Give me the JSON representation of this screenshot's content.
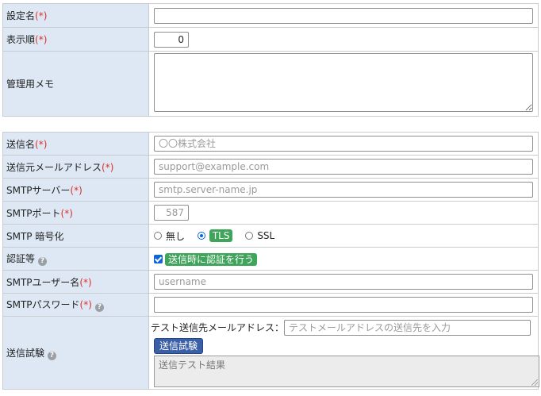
{
  "section1": {
    "setting_name_label": "設定名",
    "setting_name_value": "",
    "order_label": "表示順",
    "order_value": "0",
    "memo_label": "管理用メモ",
    "memo_value": ""
  },
  "required_mark": "(*)",
  "section2": {
    "sender_name_label": "送信名",
    "sender_name_placeholder": "〇〇株式会社",
    "sender_addr_label": "送信元メールアドレス",
    "sender_addr_placeholder": "support@example.com",
    "server_label": "SMTPサーバー",
    "server_placeholder": "smtp.server-name.jp",
    "port_label": "SMTPポート",
    "port_placeholder": "587",
    "enc_label": "SMTP 暗号化",
    "enc_options": [
      "無し",
      "TLS",
      "SSL"
    ],
    "enc_selected": "TLS",
    "auth_label": "認証等",
    "auth_checkbox_label": "送信時に認証を行う",
    "auth_checked": true,
    "user_label": "SMTPユーザー名",
    "user_placeholder": "username",
    "password_label": "SMTPパスワード",
    "test_label": "送信試験",
    "test_addr_label": "テスト送信先メールアドレス：",
    "test_addr_placeholder": "テストメールアドレスの送信先を入力",
    "test_button": "送信試験",
    "test_result_placeholder": "送信テスト結果"
  },
  "icons": {
    "help": "question-circle-icon"
  },
  "colors": {
    "label_bg": "#dde8f4",
    "required": "#e0302a",
    "accent": "#0b66d6",
    "badge_green": "#3fa55b",
    "button": "#3b5fa6"
  }
}
